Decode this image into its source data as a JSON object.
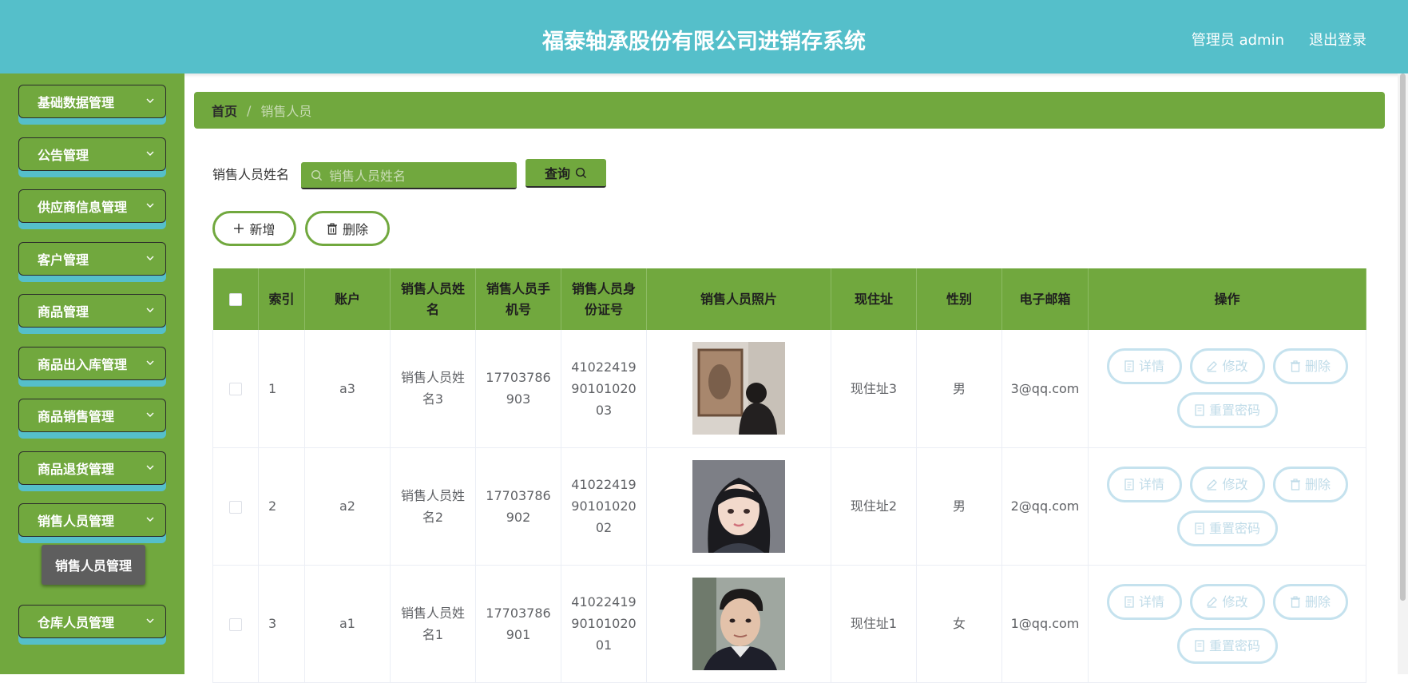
{
  "header": {
    "title": "福泰轴承股份有限公司进销存系统",
    "user": "管理员 admin",
    "logout": "退出登录"
  },
  "sidebar": {
    "items": [
      {
        "label": "基础数据管理"
      },
      {
        "label": "公告管理"
      },
      {
        "label": "供应商信息管理"
      },
      {
        "label": "客户管理"
      },
      {
        "label": "商品管理"
      },
      {
        "label": "商品出入库管理"
      },
      {
        "label": "商品销售管理"
      },
      {
        "label": "商品退货管理"
      },
      {
        "label": "销售人员管理"
      },
      {
        "label": "仓库人员管理"
      }
    ],
    "submenu": "销售人员管理"
  },
  "breadcrumb": {
    "home": "首页",
    "separator": "/",
    "current": "销售人员"
  },
  "search": {
    "label": "销售人员姓名",
    "placeholder": "销售人员姓名",
    "button": "查询"
  },
  "actions": {
    "add": "新增",
    "delete": "删除"
  },
  "table": {
    "columns": [
      "索引",
      "账户",
      "销售人员姓名",
      "销售人员手机号",
      "销售人员身份证号",
      "销售人员照片",
      "现住址",
      "性别",
      "电子邮箱",
      "操作"
    ],
    "rows": [
      {
        "index": "1",
        "account": "a3",
        "name": "销售人员姓名3",
        "phone": "17703786903",
        "idcard": "410224199010102003",
        "photo": "person-back-photo",
        "address": "现住址3",
        "gender": "男",
        "email": "3@qq.com"
      },
      {
        "index": "2",
        "account": "a2",
        "name": "销售人员姓名2",
        "phone": "17703786902",
        "idcard": "410224199010102002",
        "photo": "woman-portrait-photo",
        "address": "现住址2",
        "gender": "男",
        "email": "2@qq.com"
      },
      {
        "index": "3",
        "account": "a1",
        "name": "销售人员姓名1",
        "phone": "17703786901",
        "idcard": "410224199010102001",
        "photo": "man-portrait-photo",
        "address": "现住址1",
        "gender": "女",
        "email": "1@qq.com"
      }
    ],
    "ops": {
      "detail": "详情",
      "edit": "修改",
      "delete": "删除",
      "reset": "重置密码"
    }
  },
  "colors": {
    "header": "#55bfca",
    "sidebar": "#71a83e",
    "accent_green": "#71a83e",
    "accent_blue": "#55bfca",
    "op_border": "#c5e2ee"
  }
}
